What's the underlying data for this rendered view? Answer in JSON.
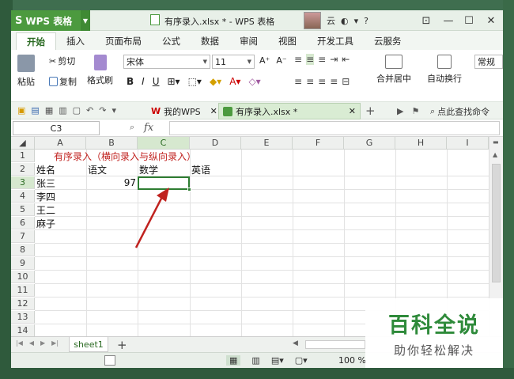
{
  "app": {
    "name": "WPS 表格",
    "logo": "S"
  },
  "window": {
    "title": "有序录入.xlsx * - WPS 表格",
    "cloud_label": "云"
  },
  "menu_tabs": [
    "开始",
    "插入",
    "页面布局",
    "公式",
    "数据",
    "审阅",
    "视图",
    "开发工具",
    "云服务"
  ],
  "ribbon": {
    "paste": "粘贴",
    "cut": "剪切",
    "copy": "复制",
    "format_painter": "格式刷",
    "font_name": "宋体",
    "font_size": "11",
    "merge_center": "合并居中",
    "auto_wrap": "自动换行",
    "number_format": "常规",
    "grow_font": "A⁺",
    "shrink_font": "A⁻",
    "bold": "B",
    "italic": "I",
    "underline": "U"
  },
  "doc_tabs": {
    "my_wps": "我的WPS",
    "current_file": "有序录入.xlsx *",
    "search": "点此查找命令"
  },
  "formula_bar": {
    "name_box": "C3",
    "fx": "fx",
    "value": ""
  },
  "columns": [
    "A",
    "B",
    "C",
    "D",
    "E",
    "F",
    "G",
    "H",
    "I"
  ],
  "rows": [
    "1",
    "2",
    "3",
    "4",
    "5",
    "6",
    "7",
    "8",
    "9",
    "10",
    "11",
    "12",
    "13",
    "14"
  ],
  "cells": {
    "a1": "有序录入（横向录入与纵向录入）",
    "a2": "姓名",
    "b2": "语文",
    "c2": "数学",
    "d2": "英语",
    "a3": "张三",
    "b3": "97",
    "a4": "李四",
    "a5": "王二",
    "a6": "麻子"
  },
  "sheet_tabs": [
    "sheet1"
  ],
  "status": {
    "zoom": "100 %"
  },
  "watermark": {
    "title": "百科全说",
    "subtitle": "助你轻松解决"
  },
  "colors": {
    "accent": "#4c9a3f",
    "selection": "#2e7d32",
    "annotation": "#c0221f",
    "title_text": "#c0221f"
  }
}
